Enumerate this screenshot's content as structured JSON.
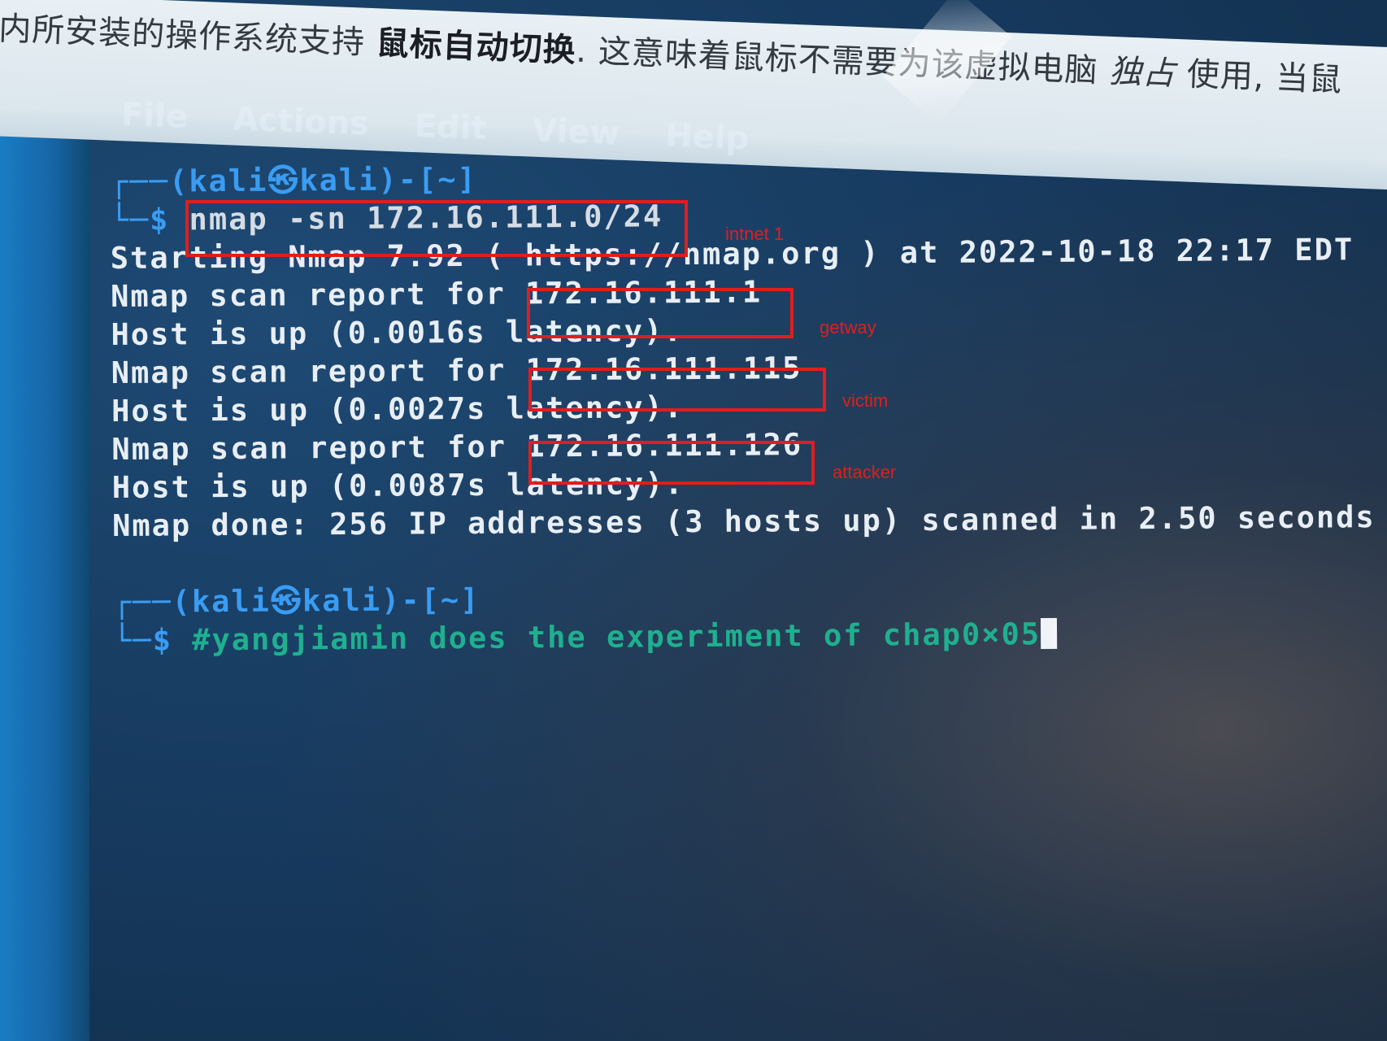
{
  "host_banner": {
    "text_before": "内所安装的操作系统支持 ",
    "bold": "鼠标自动切换",
    "text_middle": ". 这意味着鼠标不需要为该虚拟电脑 ",
    "italic": "独占",
    "text_after": " 使用, 当鼠"
  },
  "menu": {
    "file": "File",
    "actions": "Actions",
    "edit": "Edit",
    "view": "View",
    "help": "Help"
  },
  "terminal": {
    "prompt1_top": "┌──(kali㉿kali)-[~]",
    "prompt1_symbol": "└─$ ",
    "command": "nmap -sn 172.16.111.0/24",
    "starting": "Starting Nmap 7.92 ( https://nmap.org ) at 2022-10-18 22:17 EDT",
    "report_prefix": "Nmap scan report for ",
    "ip1": "172.16.111.1",
    "host_up1": "Host is up (0.0016s latency).",
    "ip2": "172.16.111.115",
    "host_up2": "Host is up (0.0027s latency).",
    "ip3": "172.16.111.126",
    "host_up3": "Host is up (0.0087s latency).",
    "done": "Nmap done: 256 IP addresses (3 hosts up) scanned in 2.50 seconds",
    "prompt2_top": "┌──(kali㉿kali)-[~]",
    "prompt2_symbol": "└─$ ",
    "comment": "#yangjiamin does the experiment of chap0×05"
  },
  "annotations": {
    "intnet": "intnet 1",
    "getway": "getway",
    "victim": "victim",
    "attacker": "attacker"
  },
  "colors": {
    "annotation_red": "#e01e1e",
    "prompt_blue": "#3a9cf2",
    "comment_green": "#1fb08f"
  }
}
